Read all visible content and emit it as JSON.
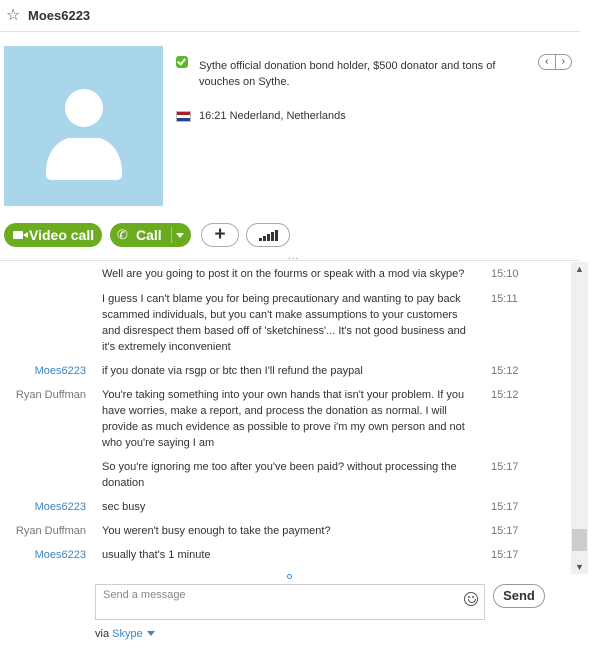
{
  "header": {
    "contact_name": "Moes6223",
    "star_icon": "star-outline-icon"
  },
  "profile": {
    "mood": "Sythe official donation bond holder, $500 donator and tons of vouches on Sythe.",
    "location": "16:21 Nederland, Netherlands",
    "avatar_bg": "#a9d6ea",
    "flag_colors": [
      "#ae1c28",
      "#ffffff",
      "#21468b"
    ]
  },
  "actions": {
    "video_call": "Video call",
    "call": "Call",
    "add": "+",
    "dots": "...",
    "accent": "#6aab1f"
  },
  "messages": [
    {
      "sender": "",
      "text": "Well are you going to post it on the fourms or speak with a mod via skype?",
      "time": "15:10"
    },
    {
      "sender": "",
      "text": "I guess I can't blame you for being precautionary and wanting to pay back scammed individuals, but you can't make assumptions to your customers and disrespect them based off of 'sketchiness'... It's not good business and it's extremely inconvenient",
      "time": "15:11"
    },
    {
      "sender": "Moes6223",
      "text": "if you donate via rsgp or btc then I'll refund the paypal",
      "time": "15:12"
    },
    {
      "sender": "Ryan Duffman",
      "text": "You're taking something into your own hands that isn't your problem. If you have worries, make a report, and process the donation as normal. I will provide as much evidence as possible to prove i'm my own person and not who you're saying I am",
      "time": "15:12"
    },
    {
      "sender": "",
      "text": "So you're ignoring me too after you've been paid? without processing the donation",
      "time": "15:17"
    },
    {
      "sender": "Moes6223",
      "text": "sec busy",
      "time": "15:17"
    },
    {
      "sender": "Ryan Duffman",
      "text": "You weren't busy enough to take the payment?",
      "time": "15:17"
    },
    {
      "sender": "Moes6223",
      "text": "usually that's 1 minute",
      "time": "15:17"
    }
  ],
  "composer": {
    "placeholder": "Send a message",
    "send_label": "Send",
    "via_label": "via",
    "via_service": "Skype"
  }
}
